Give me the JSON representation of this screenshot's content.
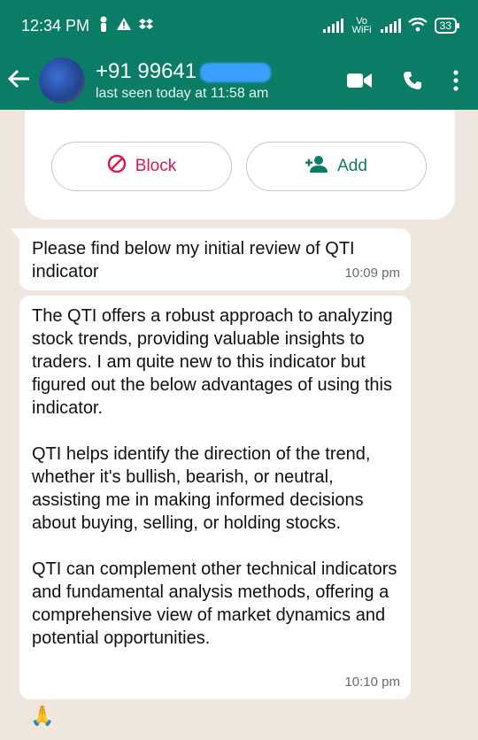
{
  "status_bar": {
    "time": "12:34 PM",
    "network_label": "Vo WiFi",
    "battery": "33"
  },
  "chat_header": {
    "contact": "+91 99641",
    "last_seen": "last seen today at 11:58 am"
  },
  "info_card": {
    "block_label": "Block",
    "add_label": "Add"
  },
  "messages": [
    {
      "text": "Please find below my initial review of QTI indicator",
      "time": "10:09 pm"
    },
    {
      "text": "The QTI offers a robust approach to analyzing stock trends, providing valuable insights to traders. I am quite new to this indicator but figured out the below advantages of using this indicator.\n\nQTI helps identify the direction of the trend, whether it's bullish, bearish, or neutral, assisting me in making informed decisions about buying, selling, or holding stocks.\n\nQTI can complement other technical indicators and fundamental analysis methods, offering a comprehensive view of market dynamics and potential opportunities.",
      "time": "10:10 pm"
    }
  ],
  "reaction": "🙏",
  "colors": {
    "header": "#0b7d67",
    "block": "#d61a4a",
    "add": "#0b7d67",
    "chat_bg": "#efe7de"
  },
  "icons": [
    "person-icon",
    "warning-icon",
    "dropbox-icon",
    "signal-icon",
    "wifi-icon",
    "battery-icon",
    "back-arrow-icon",
    "video-call-icon",
    "phone-icon",
    "more-vert-icon",
    "block-icon",
    "add-contact-icon"
  ]
}
